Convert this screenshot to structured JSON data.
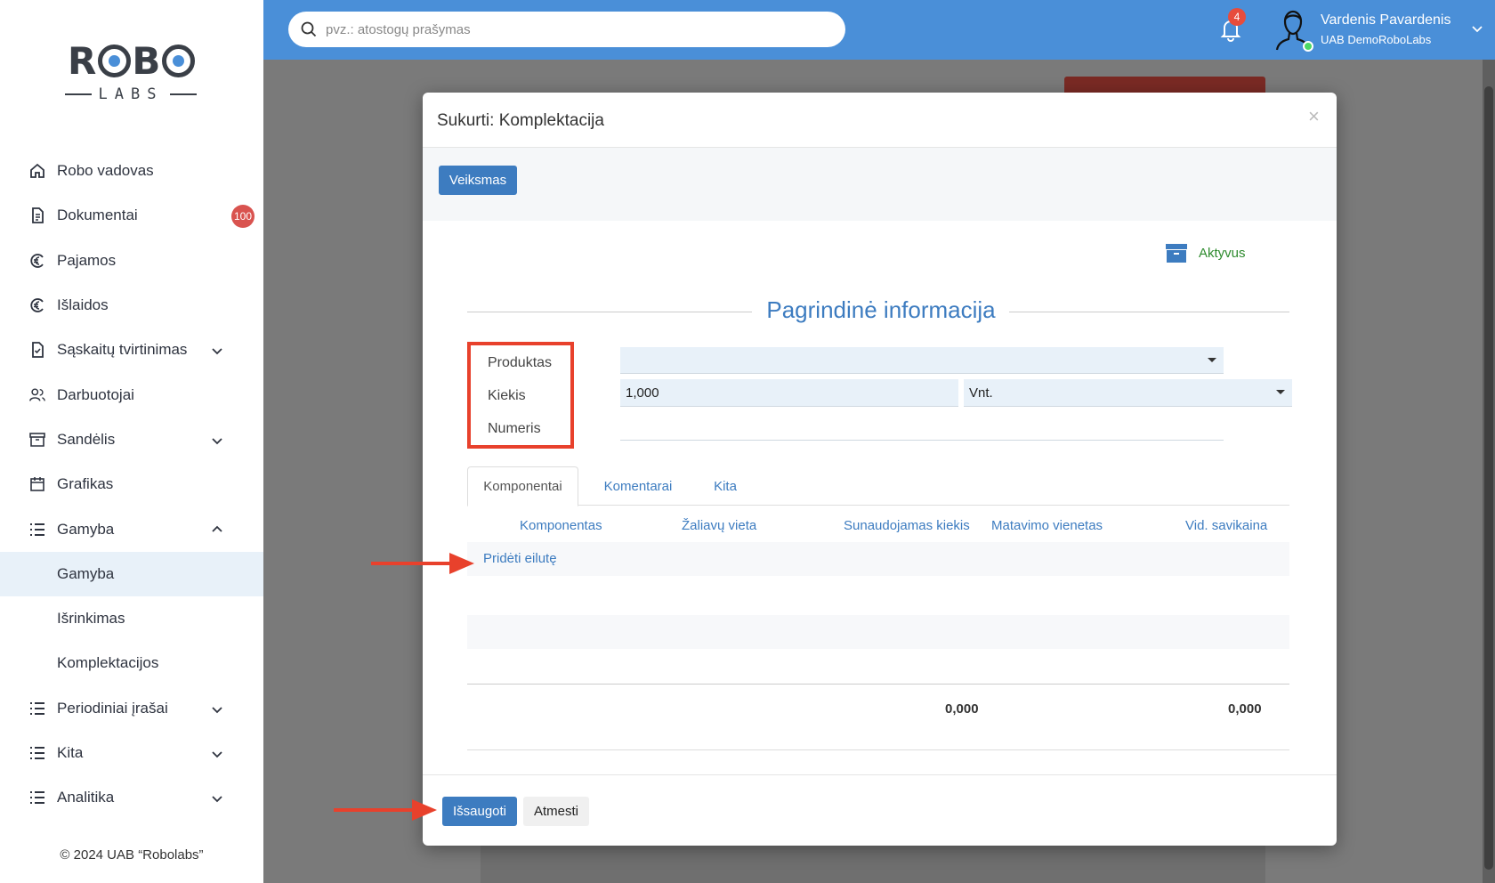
{
  "sidebar": {
    "logo": {
      "top": "ROBO",
      "bottom": "LABS"
    },
    "items": [
      {
        "label": "Robo vadovas",
        "icon": "home-icon"
      },
      {
        "label": "Dokumentai",
        "icon": "document-icon",
        "badge": "100"
      },
      {
        "label": "Pajamos",
        "icon": "euro-in-icon"
      },
      {
        "label": "Išlaidos",
        "icon": "euro-out-icon"
      },
      {
        "label": "Sąskaitų tvirtinimas",
        "icon": "invoice-check-icon"
      },
      {
        "label": "Darbuotojai",
        "icon": "users-icon"
      },
      {
        "label": "Sandėlis",
        "icon": "warehouse-icon"
      },
      {
        "label": "Grafikas",
        "icon": "calendar-icon"
      },
      {
        "label": "Gamyba",
        "icon": "list-icon"
      },
      {
        "label": "Gamyba"
      },
      {
        "label": "Išrinkimas"
      },
      {
        "label": "Komplektacijos"
      },
      {
        "label": "Periodiniai įrašai",
        "icon": "list-icon"
      },
      {
        "label": "Kita",
        "icon": "list-icon"
      },
      {
        "label": "Analitika",
        "icon": "list-icon"
      }
    ],
    "copyright": "© 2024 UAB “Robolabs”"
  },
  "topbar": {
    "search_placeholder": "pvz.: atostogų prašymas",
    "notifications_count": "4",
    "user_name": "Vardenis Pavardenis",
    "company": "UAB DemoRoboLabs"
  },
  "modal": {
    "title": "Sukurti: Komplektacija",
    "close": "×",
    "action_button": "Veiksmas",
    "status": "Aktyvus",
    "section_title": "Pagrindinė informacija",
    "form": {
      "product_label": "Produktas",
      "product_value": "",
      "quantity_label": "Kiekis",
      "quantity_value": "1,000",
      "unit_value": "Vnt.",
      "number_label": "Numeris",
      "number_value": ""
    },
    "tabs": [
      "Komponentai",
      "Komentarai",
      "Kita"
    ],
    "table": {
      "headers": [
        "Komponentas",
        "Žaliavų vieta",
        "Sunaudojamas kiekis",
        "Matavimo vienetas",
        "Vid. savikaina"
      ],
      "add_row": "Pridėti eilutę",
      "total_quantity": "0,000",
      "total_cost": "0,000"
    },
    "footer": {
      "save": "Išsaugoti",
      "cancel": "Atmesti"
    }
  },
  "colors": {
    "primary": "#3d7cc0",
    "topbar": "#4a8fd8",
    "highlight": "#e8412c",
    "status_active": "#2e8b2e"
  }
}
